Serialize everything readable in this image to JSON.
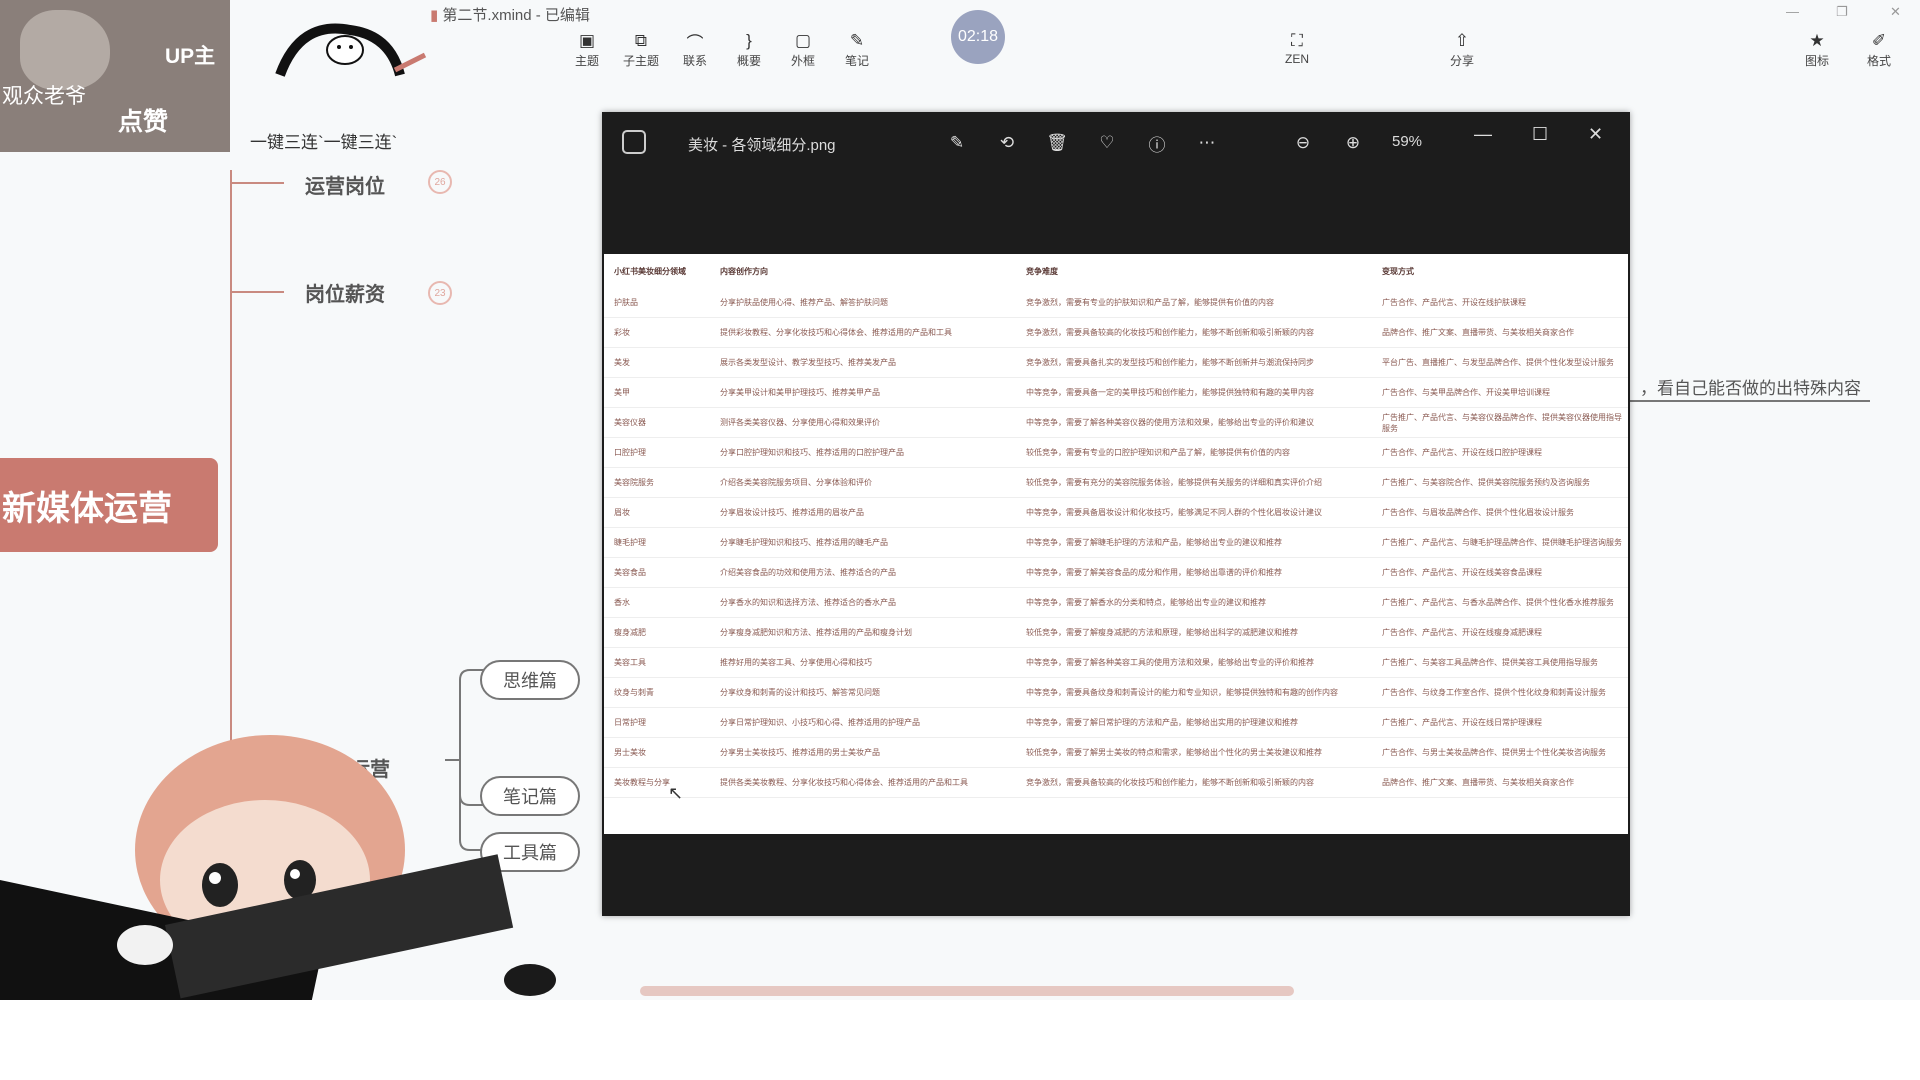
{
  "window": {
    "title": "第二节.xmind - 已编辑"
  },
  "toolbar": {
    "items": [
      {
        "label": "主题",
        "icon": "topic-icon"
      },
      {
        "label": "子主题",
        "icon": "subtopic-icon"
      },
      {
        "label": "联系",
        "icon": "relationship-icon"
      },
      {
        "label": "概要",
        "icon": "summary-icon"
      },
      {
        "label": "外框",
        "icon": "boundary-icon"
      },
      {
        "label": "笔记",
        "icon": "note-icon"
      }
    ],
    "zen_label": "ZEN",
    "share_label": "分享",
    "icons_label": "图标",
    "format_label": "格式"
  },
  "timer": {
    "value": "02:18"
  },
  "overlay": {
    "up_label": "UP主",
    "viewers_label": "观众老爷",
    "like_label": "点赞"
  },
  "mindmap": {
    "sanlian": "一键三连`一键三连`",
    "central": "新媒体运营",
    "branches": [
      {
        "label": "运营岗位",
        "badge": "26"
      },
      {
        "label": "岗位薪资",
        "badge": "23"
      }
    ],
    "sub_topic": "书运营",
    "pills": [
      "思维篇",
      "笔记篇",
      "工具篇"
    ],
    "right_note": "，看自己能否做的出特殊内容"
  },
  "viewer": {
    "filename": "美妆 - 各领域细分.png",
    "zoom": "59%",
    "table": {
      "headers": [
        "小红书美妆细分领域",
        "内容创作方向",
        "竞争难度",
        "变现方式"
      ],
      "rows": [
        [
          "护肤品",
          "分享护肤品使用心得、推荐产品、解答护肤问题",
          "竞争激烈，需要有专业的护肤知识和产品了解，能够提供有价值的内容",
          "广告合作、产品代言、开设在线护肤课程"
        ],
        [
          "彩妆",
          "提供彩妆教程、分享化妆技巧和心得体会、推荐适用的产品和工具",
          "竞争激烈，需要具备较高的化妆技巧和创作能力，能够不断创新和吸引新颖的内容",
          "品牌合作、推广文案、直播带货、与美妆相关商家合作"
        ],
        [
          "美发",
          "展示各类发型设计、教学发型技巧、推荐美发产品",
          "竞争激烈，需要具备扎实的发型技巧和创作能力，能够不断创新并与潮流保持同步",
          "平台广告、直播推广、与发型品牌合作、提供个性化发型设计服务"
        ],
        [
          "美甲",
          "分享美甲设计和美甲护理技巧、推荐美甲产品",
          "中等竞争，需要具备一定的美甲技巧和创作能力，能够提供独特和有趣的美甲内容",
          "广告合作、与美甲品牌合作、开设美甲培训课程"
        ],
        [
          "美容仪器",
          "测评各类美容仪器、分享使用心得和效果评价",
          "中等竞争，需要了解各种美容仪器的使用方法和效果，能够给出专业的评价和建议",
          "广告推广、产品代言、与美容仪器品牌合作、提供美容仪器使用指导服务"
        ],
        [
          "口腔护理",
          "分享口腔护理知识和技巧、推荐适用的口腔护理产品",
          "较低竞争，需要有专业的口腔护理知识和产品了解，能够提供有价值的内容",
          "广告合作、产品代言、开设在线口腔护理课程"
        ],
        [
          "美容院服务",
          "介绍各类美容院服务项目、分享体验和评价",
          "较低竞争，需要有充分的美容院服务体验，能够提供有关服务的详细和真实评价介绍",
          "广告推广、与美容院合作、提供美容院服务预约及咨询服务"
        ],
        [
          "眉妆",
          "分享眉妆设计技巧、推荐适用的眉妆产品",
          "中等竞争，需要具备眉妆设计和化妆技巧，能够满足不同人群的个性化眉妆设计建议",
          "广告合作、与眉妆品牌合作、提供个性化眉妆设计服务"
        ],
        [
          "睫毛护理",
          "分享睫毛护理知识和技巧、推荐适用的睫毛产品",
          "中等竞争，需要了解睫毛护理的方法和产品，能够给出专业的建议和推荐",
          "广告推广、产品代言、与睫毛护理品牌合作、提供睫毛护理咨询服务"
        ],
        [
          "美容食品",
          "介绍美容食品的功效和使用方法、推荐适合的产品",
          "中等竞争，需要了解美容食品的成分和作用，能够给出靠谱的评价和推荐",
          "广告合作、产品代言、开设在线美容食品课程"
        ],
        [
          "香水",
          "分享香水的知识和选择方法、推荐适合的香水产品",
          "中等竞争，需要了解香水的分类和特点，能够给出专业的建议和推荐",
          "广告推广、产品代言、与香水品牌合作、提供个性化香水推荐服务"
        ],
        [
          "瘦身减肥",
          "分享瘦身减肥知识和方法、推荐适用的产品和瘦身计划",
          "较低竞争，需要了解瘦身减肥的方法和原理，能够给出科学的减肥建议和推荐",
          "广告合作、产品代言、开设在线瘦身减肥课程"
        ],
        [
          "美容工具",
          "推荐好用的美容工具、分享使用心得和技巧",
          "中等竞争，需要了解各种美容工具的使用方法和效果，能够给出专业的评价和推荐",
          "广告推广、与美容工具品牌合作、提供美容工具使用指导服务"
        ],
        [
          "纹身与刺青",
          "分享纹身和刺青的设计和技巧、解答常见问题",
          "中等竞争，需要具备纹身和刺青设计的能力和专业知识，能够提供独特和有趣的创作内容",
          "广告合作、与纹身工作室合作、提供个性化纹身和刺青设计服务"
        ],
        [
          "日常护理",
          "分享日常护理知识、小技巧和心得、推荐适用的护理产品",
          "中等竞争，需要了解日常护理的方法和产品，能够给出实用的护理建议和推荐",
          "广告推广、产品代言、开设在线日常护理课程"
        ],
        [
          "男士美妆",
          "分享男士美妆技巧、推荐适用的男士美妆产品",
          "较低竞争，需要了解男士美妆的特点和需求，能够给出个性化的男士美妆建议和推荐",
          "广告合作、与男士美妆品牌合作、提供男士个性化美妆咨询服务"
        ],
        [
          "美妆教程与分享",
          "提供各类美妆教程、分享化妆技巧和心得体会、推荐适用的产品和工具",
          "竞争激烈，需要具备较高的化妆技巧和创作能力，能够不断创新和吸引新颖的内容",
          "品牌合作、推广文案、直播带货、与美妆相关商家合作"
        ]
      ]
    }
  }
}
